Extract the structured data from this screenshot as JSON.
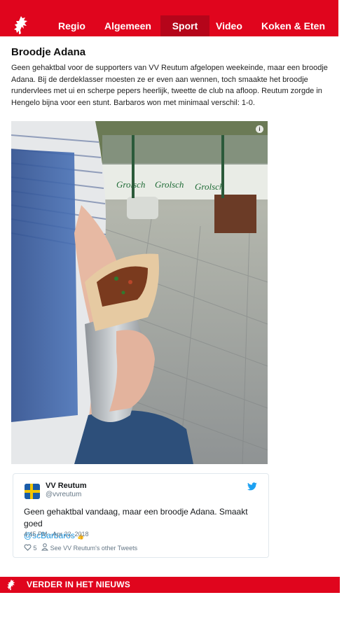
{
  "nav": {
    "items": [
      {
        "label": "Regio"
      },
      {
        "label": "Algemeen"
      },
      {
        "label": "Sport",
        "active": true
      },
      {
        "label": "Video"
      },
      {
        "label": "Koken & Eten"
      }
    ]
  },
  "article": {
    "title": "Broodje Adana",
    "body": "Geen gehaktbal voor de supporters van VV Reutum afgelopen weekeinde, maar een broodje Adana. Bij de derdeklasser moesten ze er even aan wennen, toch smaakte het broodje rundervlees met ui en scherpe pepers heerlijk, tweette de club na afloop. Reutum zorgde in Hengelo bijna voor een stunt. Barbaros won met minimaal verschil: 1-0."
  },
  "photo": {
    "banner_text": "Grolsch",
    "info_icon": "info-icon"
  },
  "tweet": {
    "name": "VV Reutum",
    "handle": "@vvreutum",
    "text": "Geen gehaktbal vandaag, maar een broodje Adana. Smaakt goed",
    "mention": "@scBarbaros",
    "emoji": "👍",
    "time": "4:45 PM - Apr 22, 2018",
    "likes": "5",
    "other_tweets": "See VV Reutum's other Tweets"
  },
  "more_news": {
    "title": "VERDER IN HET NIEUWS"
  },
  "colors": {
    "brand_red": "#e0051d",
    "active_red": "#b5051a",
    "twitter_blue": "#1b95e0"
  }
}
